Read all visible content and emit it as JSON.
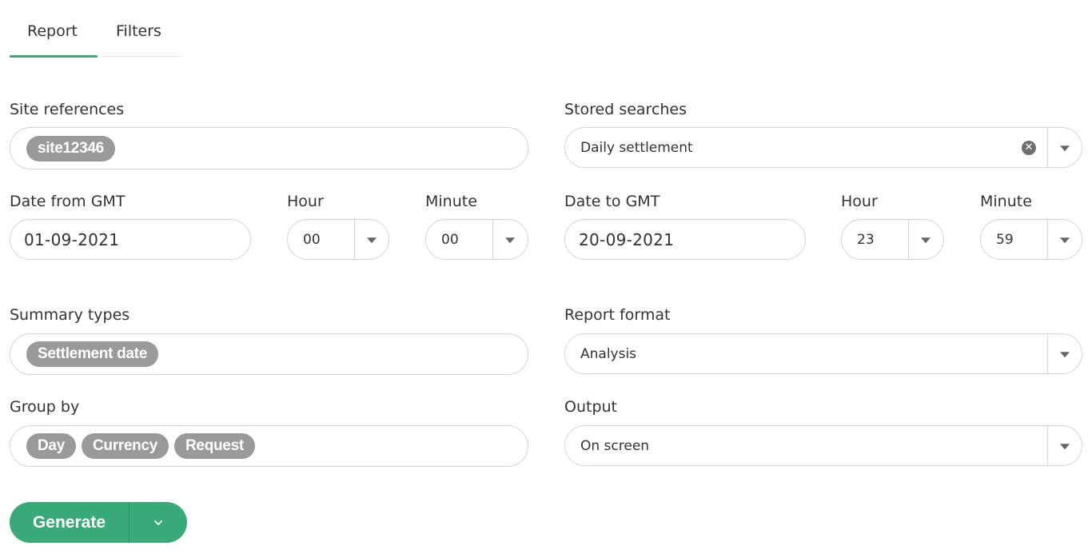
{
  "tabs": {
    "report": "Report",
    "filters": "Filters"
  },
  "accent_color": "#3aaa78",
  "chip_color": "#9a9a9a",
  "site_references": {
    "label": "Site references",
    "chips": [
      "site12346"
    ]
  },
  "stored_searches": {
    "label": "Stored searches",
    "value": "Daily settlement",
    "clear_icon": "clear-circle-icon"
  },
  "date_from": {
    "label": "Date from GMT",
    "value": "01-09-2021",
    "hour_label": "Hour",
    "hour_value": "00",
    "minute_label": "Minute",
    "minute_value": "00"
  },
  "date_to": {
    "label": "Date to GMT",
    "value": "20-09-2021",
    "hour_label": "Hour",
    "hour_value": "23",
    "minute_label": "Minute",
    "minute_value": "59"
  },
  "summary_types": {
    "label": "Summary types",
    "chips": [
      "Settlement date"
    ]
  },
  "report_format": {
    "label": "Report format",
    "value": "Analysis"
  },
  "group_by": {
    "label": "Group by",
    "chips": [
      "Day",
      "Currency",
      "Request"
    ]
  },
  "output": {
    "label": "Output",
    "value": "On screen"
  },
  "generate": {
    "label": "Generate",
    "dropdown_icon": "chevron-down-icon"
  }
}
